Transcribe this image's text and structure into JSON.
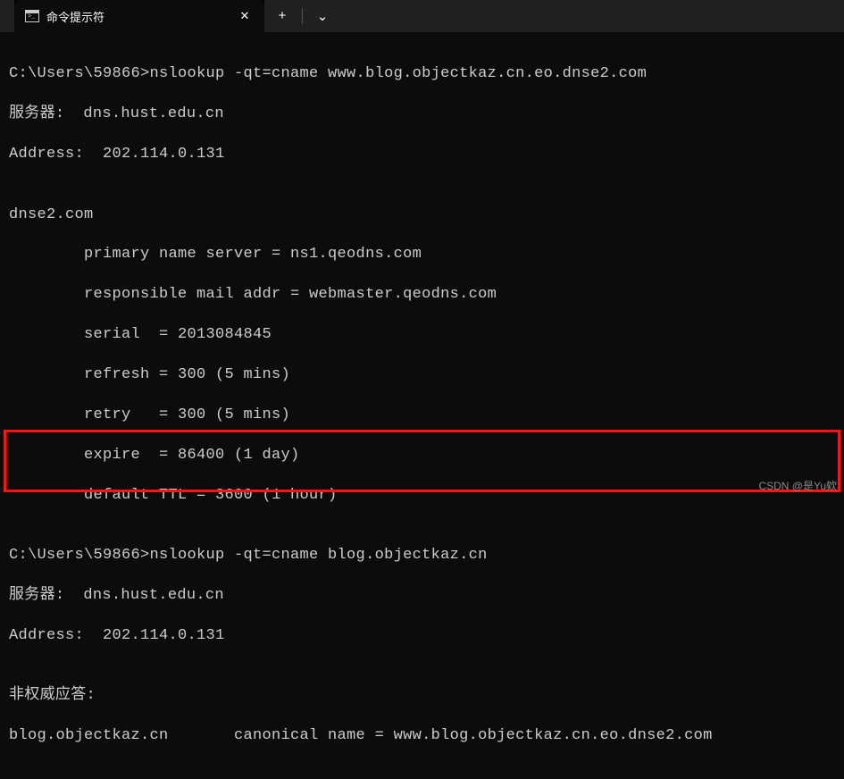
{
  "window": {
    "tab_title": "命令提示符",
    "close_glyph": "✕",
    "new_tab_glyph": "+",
    "dropdown_glyph": "⌄"
  },
  "terminal": {
    "line1": "C:\\Users\\59866>nslookup -qt=cname www.blog.objectkaz.cn.eo.dnse2.com",
    "line2": "服务器:  dns.hust.edu.cn",
    "line3": "Address:  202.114.0.131",
    "blank1": "",
    "line4": "dnse2.com",
    "line5": "        primary name server = ns1.qeodns.com",
    "line6": "        responsible mail addr = webmaster.qeodns.com",
    "line7": "        serial  = 2013084845",
    "line8": "        refresh = 300 (5 mins)",
    "line9": "        retry   = 300 (5 mins)",
    "line10": "        expire  = 86400 (1 day)",
    "line11": "        default TTL = 3600 (1 hour)",
    "blank2": "",
    "line12": "C:\\Users\\59866>nslookup -qt=cname blog.objectkaz.cn",
    "line13": "服务器:  dns.hust.edu.cn",
    "line14": "Address:  202.114.0.131",
    "blank3": "",
    "line15": "非权威应答:",
    "line16": "blog.objectkaz.cn       canonical name = www.blog.objectkaz.cn.eo.dnse2.com"
  },
  "watermark": "CSDN @是Yu欸"
}
